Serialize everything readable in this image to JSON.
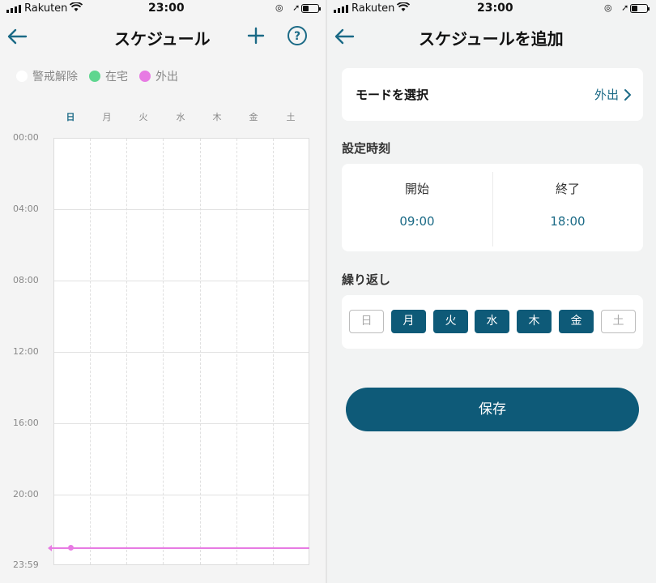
{
  "status_bar": {
    "carrier": "Rakuten",
    "time": "23:00"
  },
  "schedule": {
    "title": "スケジュール",
    "legend": [
      {
        "label": "警戒解除",
        "color": "#ffffff"
      },
      {
        "label": "在宅",
        "color": "#5fd68f"
      },
      {
        "label": "外出",
        "color": "#e77be3"
      }
    ],
    "weekdays": [
      "日",
      "月",
      "火",
      "水",
      "木",
      "金",
      "土"
    ],
    "time_labels": [
      "00:00",
      "04:00",
      "08:00",
      "12:00",
      "16:00",
      "20:00",
      "23:59"
    ],
    "add_icon": "plus-icon",
    "help_icon": "help-circle-icon"
  },
  "add_schedule": {
    "title": "スケジュールを追加",
    "mode": {
      "label": "モードを選択",
      "value": "外出"
    },
    "time_section": "設定時刻",
    "start": {
      "label": "開始",
      "value": "09:00"
    },
    "end": {
      "label": "終了",
      "value": "18:00"
    },
    "repeat_section": "繰り返し",
    "days": [
      {
        "label": "日",
        "selected": false
      },
      {
        "label": "月",
        "selected": true
      },
      {
        "label": "火",
        "selected": true
      },
      {
        "label": "水",
        "selected": true
      },
      {
        "label": "木",
        "selected": true
      },
      {
        "label": "金",
        "selected": true
      },
      {
        "label": "土",
        "selected": false
      }
    ],
    "save_label": "保存"
  },
  "colors": {
    "accent": "#0e5a78",
    "link": "#1b6a86",
    "away": "#e77be3"
  }
}
